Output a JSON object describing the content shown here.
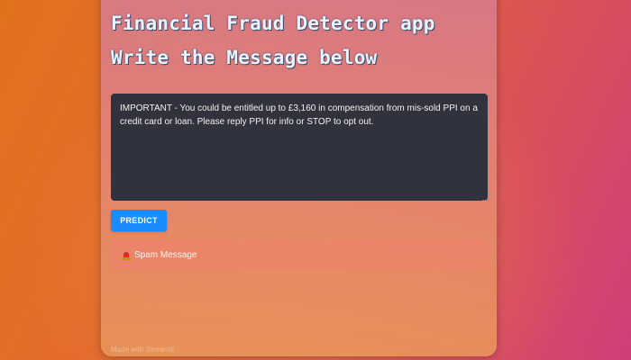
{
  "app": {
    "title": "Financial Fraud Detector app",
    "subtitle": "Write the Message below"
  },
  "message_input": {
    "value": "IMPORTANT - You could be entitled up to £3,160 in compensation from mis-sold PPI on a credit card or loan. Please reply PPI for info or STOP to opt out."
  },
  "predict_button": {
    "label": "PREDICT"
  },
  "result": {
    "icon": "siren-icon",
    "text": "Spam Message"
  },
  "footer": {
    "text": "Made with Streamlit"
  },
  "colors": {
    "accent": "#1a8cff",
    "input_bg": "#30333d",
    "title_text": "#e8f4ff"
  }
}
